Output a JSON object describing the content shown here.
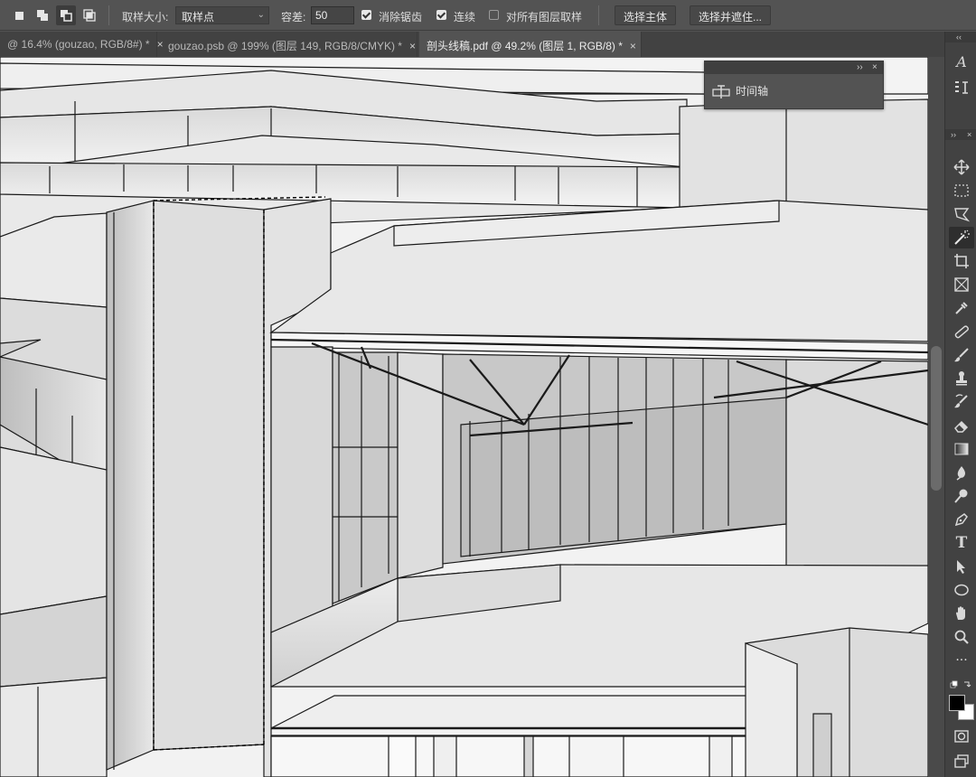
{
  "options_bar": {
    "sample_size_label": "取样大小:",
    "sample_size_value": "取样点",
    "tolerance_label": "容差:",
    "tolerance_value": "50",
    "anti_alias_label": "消除锯齿",
    "anti_alias_checked": true,
    "contiguous_label": "连续",
    "contiguous_checked": true,
    "sample_all_layers_label": "对所有图层取样",
    "sample_all_layers_checked": false,
    "select_subject_button": "选择主体",
    "select_and_mask_button": "选择并遮住..."
  },
  "tabs": [
    {
      "label": "@ 16.4% (gouzao, RGB/8#) *",
      "close": "×",
      "active": false
    },
    {
      "label": "gouzao.psb @ 199% (图层 149, RGB/8/CMYK) *",
      "close": "×",
      "active": false
    },
    {
      "label": "剖头线稿.pdf @ 49.2% (图层 1, RGB/8) *",
      "close": "×",
      "active": true
    }
  ],
  "timeline_panel": {
    "collapse_glyph": "››",
    "close_glyph": "×",
    "title": "时间轴",
    "icon": "timeline-icon"
  },
  "right_panel": {
    "top_collapse_glyph": "‹‹",
    "tools_header_glyph": "››",
    "tools_close_glyph": "×",
    "character_glyph": "A",
    "paragraph_icon": "paragraph-icon",
    "tools": [
      {
        "name": "move-tool",
        "icon": "move-icon",
        "active": false
      },
      {
        "name": "marquee-tool",
        "icon": "marquee-icon",
        "active": false
      },
      {
        "name": "lasso-tool",
        "icon": "lasso-icon",
        "active": false
      },
      {
        "name": "magic-wand-tool",
        "icon": "magic-wand-icon",
        "active": true
      },
      {
        "name": "crop-tool",
        "icon": "crop-icon",
        "active": false
      },
      {
        "name": "frame-tool",
        "icon": "frame-icon",
        "active": false
      },
      {
        "name": "eyedropper-tool",
        "icon": "eyedropper-icon",
        "active": false
      },
      {
        "name": "healing-brush-tool",
        "icon": "bandage-icon",
        "active": false
      },
      {
        "name": "brush-tool",
        "icon": "brush-icon",
        "active": false
      },
      {
        "name": "clone-stamp-tool",
        "icon": "stamp-icon",
        "active": false
      },
      {
        "name": "history-brush-tool",
        "icon": "history-brush-icon",
        "active": false
      },
      {
        "name": "eraser-tool",
        "icon": "eraser-icon",
        "active": false
      },
      {
        "name": "gradient-tool",
        "icon": "gradient-icon",
        "active": false
      },
      {
        "name": "blur-tool",
        "icon": "blur-icon",
        "active": false
      },
      {
        "name": "dodge-tool",
        "icon": "dodge-icon",
        "active": false
      },
      {
        "name": "pen-tool",
        "icon": "pen-icon",
        "active": false
      },
      {
        "name": "type-tool",
        "icon": "type-icon",
        "label": "T",
        "active": false
      },
      {
        "name": "path-selection-tool",
        "icon": "arrow-icon",
        "active": false
      },
      {
        "name": "ellipse-tool",
        "icon": "ellipse-icon",
        "active": false
      },
      {
        "name": "hand-tool",
        "icon": "hand-icon",
        "active": false
      },
      {
        "name": "zoom-tool",
        "icon": "zoom-icon",
        "active": false
      },
      {
        "name": "more-tools",
        "icon": "ellipsis-icon",
        "label": "···",
        "active": false
      }
    ],
    "foreground_color": "#000000",
    "background_color": "#ffffff"
  }
}
